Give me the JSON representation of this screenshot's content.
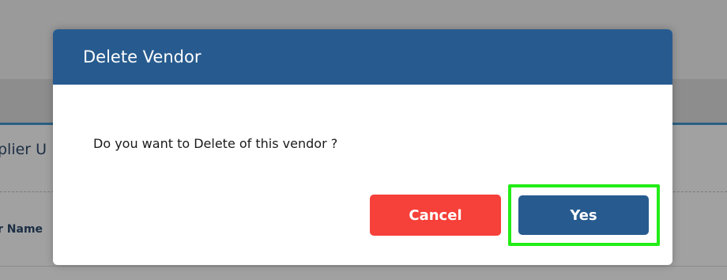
{
  "background": {
    "page_title_fragment": "plier U",
    "field_label_fragment": "r Name"
  },
  "modal": {
    "title": "Delete Vendor",
    "message": "Do you want to Delete of this vendor ?",
    "cancel_label": "Cancel",
    "yes_label": "Yes"
  },
  "colors": {
    "header": "#275b8f",
    "cancel": "#f6403a",
    "yes": "#275b8f",
    "highlight": "#23ec17"
  }
}
